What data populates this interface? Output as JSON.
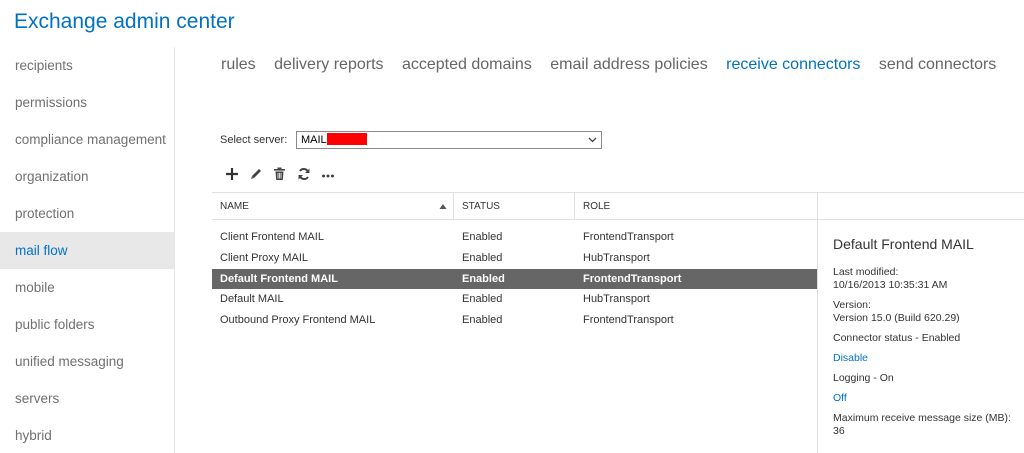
{
  "app": {
    "title": "Exchange admin center"
  },
  "sidebar": {
    "items": [
      {
        "label": "recipients"
      },
      {
        "label": "permissions"
      },
      {
        "label": "compliance management"
      },
      {
        "label": "organization"
      },
      {
        "label": "protection"
      },
      {
        "label": "mail flow"
      },
      {
        "label": "mobile"
      },
      {
        "label": "public folders"
      },
      {
        "label": "unified messaging"
      },
      {
        "label": "servers"
      },
      {
        "label": "hybrid"
      }
    ],
    "active_index": 5
  },
  "tabs": [
    {
      "label": "rules"
    },
    {
      "label": "delivery reports"
    },
    {
      "label": "accepted domains"
    },
    {
      "label": "email address policies"
    },
    {
      "label": "receive connectors"
    },
    {
      "label": "send connectors"
    }
  ],
  "active_tab_index": 4,
  "server": {
    "label": "Select server:",
    "value": "MAIL"
  },
  "toolbar": {
    "add_icon": "plus-icon",
    "edit_icon": "pencil-icon",
    "delete_icon": "trash-icon",
    "refresh_icon": "refresh-icon",
    "more_icon": "ellipsis-icon"
  },
  "grid": {
    "columns": [
      "NAME",
      "STATUS",
      "ROLE"
    ],
    "sort_column": "NAME",
    "rows": [
      {
        "name": "Client Frontend MAIL",
        "status": "Enabled",
        "role": "FrontendTransport"
      },
      {
        "name": "Client Proxy MAIL",
        "status": "Enabled",
        "role": "HubTransport"
      },
      {
        "name": "Default Frontend MAIL",
        "status": "Enabled",
        "role": "FrontendTransport"
      },
      {
        "name": "Default MAIL",
        "status": "Enabled",
        "role": "HubTransport"
      },
      {
        "name": "Outbound Proxy Frontend MAIL",
        "status": "Enabled",
        "role": "FrontendTransport"
      }
    ],
    "selected_index": 2
  },
  "details": {
    "title": "Default Frontend MAIL",
    "last_modified_label": "Last modified:",
    "last_modified_value": "10/16/2013 10:35:31 AM",
    "version_label": "Version:",
    "version_value": "Version 15.0 (Build 620.29)",
    "connector_status": "Connector status - Enabled",
    "disable_link": "Disable",
    "logging": "Logging - On",
    "off_link": "Off",
    "max_size_label": "Maximum receive message size (MB):",
    "max_size_value": "36"
  },
  "colors": {
    "accent": "#0072c6",
    "selected_row": "#666666"
  }
}
